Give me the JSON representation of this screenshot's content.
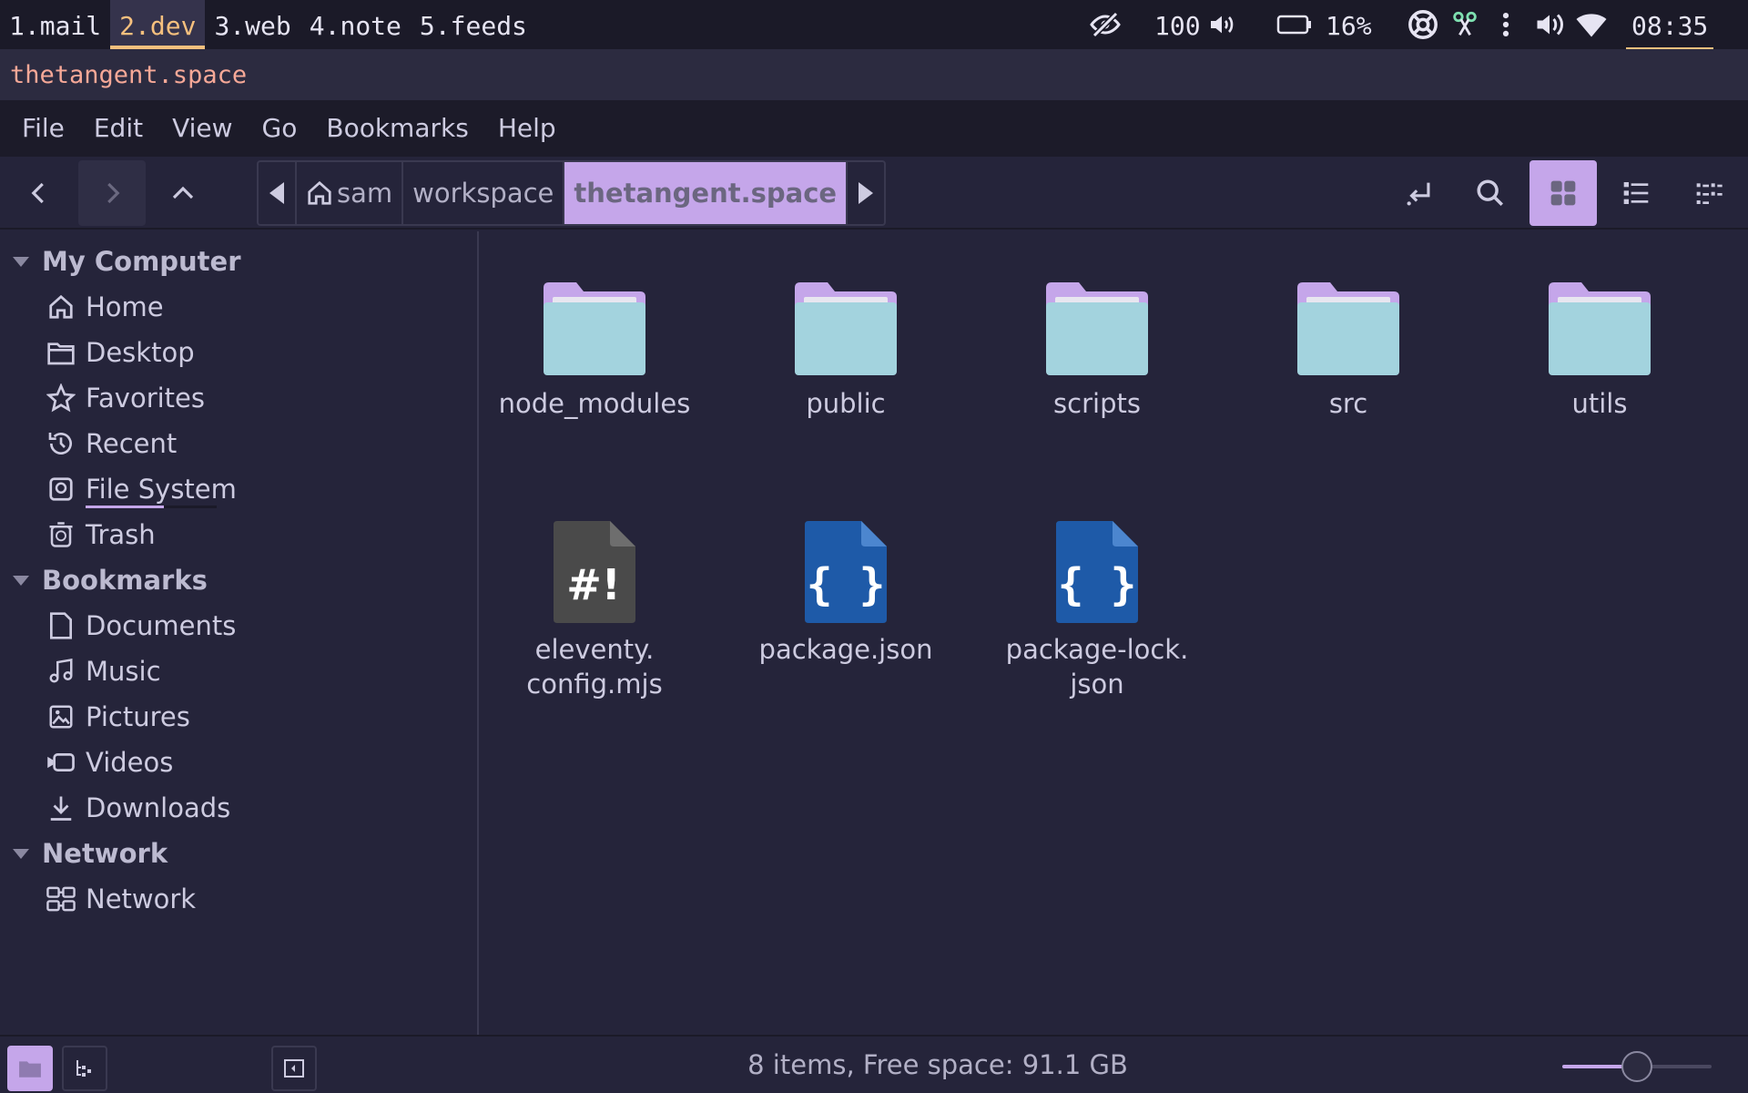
{
  "topbar": {
    "workspaces": [
      {
        "label": "1.mail",
        "active": false
      },
      {
        "label": "2.dev",
        "active": true
      },
      {
        "label": "3.web",
        "active": false
      },
      {
        "label": "4.note",
        "active": false
      },
      {
        "label": "5.feeds",
        "active": false
      }
    ],
    "volume": "100",
    "battery": "16%",
    "clock": "08:35"
  },
  "window_title": "thetangent.space",
  "menu": [
    "File",
    "Edit",
    "View",
    "Go",
    "Bookmarks",
    "Help"
  ],
  "breadcrumb": {
    "home": "sam",
    "middle": "workspace",
    "current": "thetangent.space"
  },
  "sidebar": {
    "sections": [
      {
        "title": "My Computer",
        "items": [
          "Home",
          "Desktop",
          "Favorites",
          "Recent",
          "File System",
          "Trash"
        ]
      },
      {
        "title": "Bookmarks",
        "items": [
          "Documents",
          "Music",
          "Pictures",
          "Videos",
          "Downloads"
        ]
      },
      {
        "title": "Network",
        "items": [
          "Network"
        ]
      }
    ]
  },
  "files": [
    {
      "name": "node_modules",
      "type": "folder"
    },
    {
      "name": "public",
      "type": "folder"
    },
    {
      "name": "scripts",
      "type": "folder"
    },
    {
      "name": "src",
      "type": "folder"
    },
    {
      "name": "utils",
      "type": "folder"
    },
    {
      "name_line1": "eleventy.",
      "name_line2": "config.mjs",
      "type": "script"
    },
    {
      "name": "package.json",
      "type": "json"
    },
    {
      "name_line1": "package-lock.",
      "name_line2": "json",
      "type": "json"
    }
  ],
  "status": {
    "text": "8 items, Free space: 91.1 GB",
    "zoom_level": 0.5
  },
  "colors": {
    "accent": "#c5a6ea",
    "folder_body": "#a3d3de",
    "folder_tab": "#c5a6ea",
    "json_icon": "#1e5aa8",
    "script_icon": "#4a4a4a",
    "workspace_active": "#f6c07e"
  }
}
